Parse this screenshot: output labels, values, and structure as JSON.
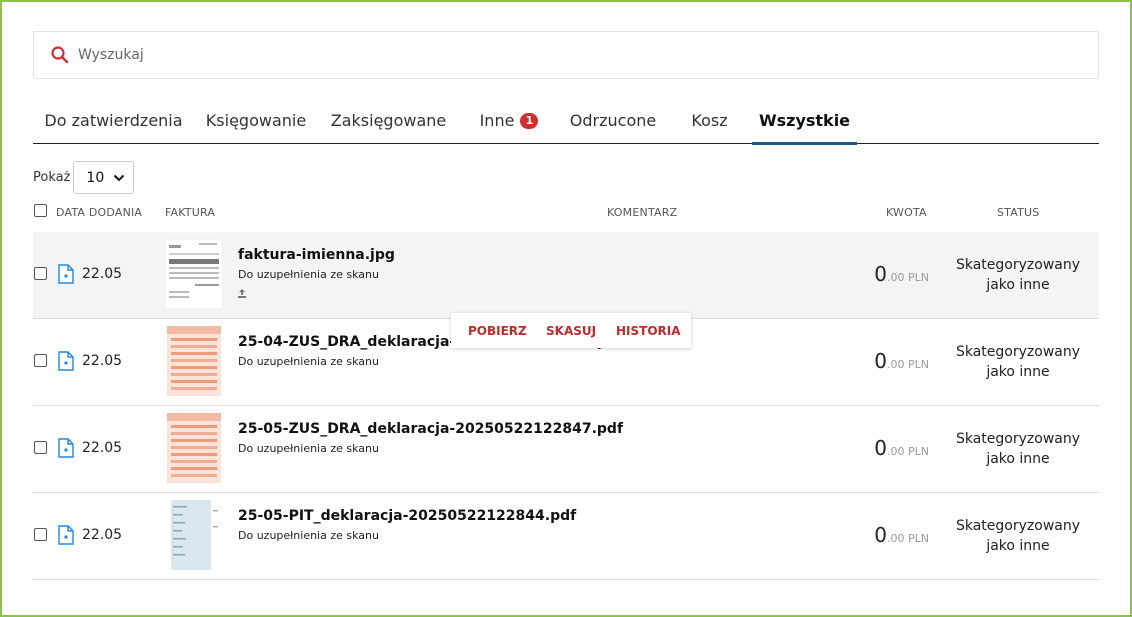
{
  "search": {
    "placeholder": "Wyszukaj"
  },
  "tabs": [
    {
      "label": "Do zatwierdzenia"
    },
    {
      "label": "Księgowanie"
    },
    {
      "label": "Zaksięgowane"
    },
    {
      "label": "Inne",
      "badge": "1"
    },
    {
      "label": "Odrzucone"
    },
    {
      "label": "Kosz"
    },
    {
      "label": "Wszystkie",
      "active": true
    }
  ],
  "show": {
    "label": "Pokaż",
    "value": "10"
  },
  "columns": {
    "date": "DATA DODANIA",
    "invoice": "FAKTURA",
    "comment": "KOMENTARZ",
    "amount": "KWOTA",
    "status": "STATUS"
  },
  "rows": [
    {
      "date": "22.05",
      "filename": "faktura-imienna.jpg",
      "subtitle": "Do uzupełnienia ze skanu",
      "amount_int": "0",
      "amount_dec": ".00 PLN",
      "status": "Skategoryzowany jako inne"
    },
    {
      "date": "22.05",
      "filename": "25-04-ZUS_DRA_deklaracja-20250522122851.pdf",
      "subtitle": "Do uzupełnienia ze skanu",
      "amount_int": "0",
      "amount_dec": ".00 PLN",
      "status": "Skategoryzowany jako inne"
    },
    {
      "date": "22.05",
      "filename": "25-05-ZUS_DRA_deklaracja-20250522122847.pdf",
      "subtitle": "Do uzupełnienia ze skanu",
      "amount_int": "0",
      "amount_dec": ".00 PLN",
      "status": "Skategoryzowany jako inne"
    },
    {
      "date": "22.05",
      "filename": "25-05-PIT_deklaracja-20250522122844.pdf",
      "subtitle": "Do uzupełnienia ze skanu",
      "amount_int": "0",
      "amount_dec": ".00 PLN",
      "status": "Skategoryzowany jako inne"
    }
  ],
  "row_actions": {
    "download": "POBIERZ",
    "delete": "SKASUJ",
    "history": "HISTORIA"
  },
  "colors": {
    "accent": "#1e5a8a",
    "danger": "#c62828",
    "badge": "#d32f2f",
    "frame": "#8bc34a"
  }
}
